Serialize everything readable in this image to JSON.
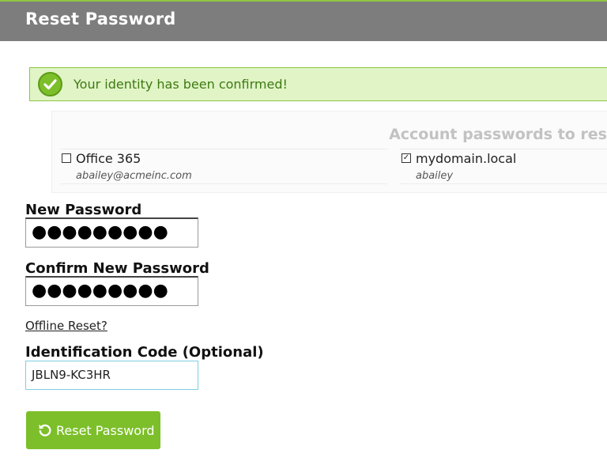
{
  "header": {
    "title": "Reset Password"
  },
  "alert": {
    "message": "Your identity has been confirmed!",
    "icon": "check-circle-icon",
    "color": "#7cbf2a"
  },
  "accounts": {
    "title": "Account passwords to reset",
    "items": [
      {
        "name": "Office 365",
        "user": "abailey@acmeinc.com",
        "checked": false
      },
      {
        "name": "mydomain.local",
        "user": "abailey",
        "checked": true
      }
    ]
  },
  "form": {
    "new_password_label": "New Password",
    "new_password_value": "●●●●●●●●●",
    "confirm_password_label": "Confirm New Password",
    "confirm_password_value": "●●●●●●●●●",
    "offline_reset_link": "Offline Reset?",
    "id_code_label": "Identification Code (Optional)",
    "id_code_value": "JBLN9-KC3HR"
  },
  "submit": {
    "label": "Reset Password",
    "icon": "refresh-icon",
    "color": "#7cbf2a"
  }
}
